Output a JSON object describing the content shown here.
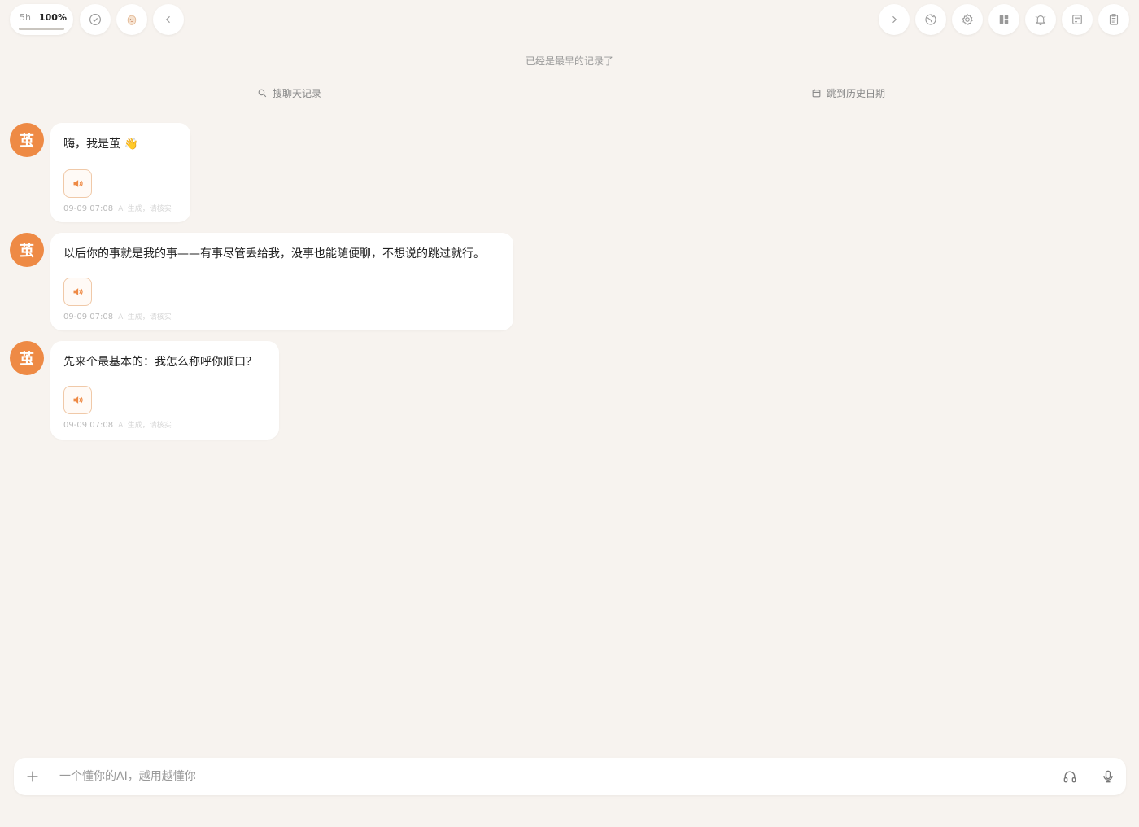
{
  "status": {
    "time_label": "5h",
    "percent_label": "100%",
    "progress_fraction": 1.0
  },
  "header": {
    "left_icons": [
      "check-circle-icon",
      "avatar-egg-icon",
      "chevron-left-icon"
    ],
    "right_icons": [
      "chevron-right-icon",
      "globe-icon",
      "gear-icon",
      "layout-icon",
      "bell-icon",
      "note-icon",
      "clipboard-icon"
    ]
  },
  "chat": {
    "earliest_notice": "已经是最早的记录了",
    "search_label": "搜聊天记录",
    "jump_label": "跳到历史日期",
    "avatar_char": "茧",
    "messages": [
      {
        "text": "嗨，我是茧 👋",
        "time": "09-09 07:08",
        "ai_note": "AI 生成，请核实"
      },
      {
        "text": "以后你的事就是我的事——有事尽管丢给我，没事也能随便聊，不想说的跳过就行。",
        "time": "09-09 07:08",
        "ai_note": "AI 生成，请核实"
      },
      {
        "text": "先来个最基本的：我怎么称呼你顺口？",
        "time": "09-09 07:08",
        "ai_note": "AI 生成，请核实"
      }
    ]
  },
  "composer": {
    "placeholder": "一个懂你的AI，越用越懂你",
    "value": ""
  },
  "colors": {
    "accent": "#ee8a45",
    "background": "#f7f3ef"
  }
}
